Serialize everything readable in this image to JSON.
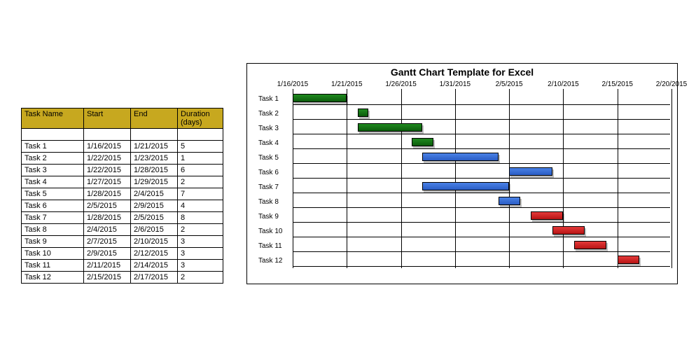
{
  "table": {
    "headers": {
      "name": "Task Name",
      "start": "Start",
      "end": "End",
      "duration": "Duration (days)"
    },
    "rows": [
      {
        "name": "Task 1",
        "start": "1/16/2015",
        "end": "1/21/2015",
        "duration": "5"
      },
      {
        "name": "Task 2",
        "start": "1/22/2015",
        "end": "1/23/2015",
        "duration": "1"
      },
      {
        "name": "Task 3",
        "start": "1/22/2015",
        "end": "1/28/2015",
        "duration": "6"
      },
      {
        "name": "Task 4",
        "start": "1/27/2015",
        "end": "1/29/2015",
        "duration": "2"
      },
      {
        "name": "Task 5",
        "start": "1/28/2015",
        "end": "2/4/2015",
        "duration": "7"
      },
      {
        "name": "Task 6",
        "start": "2/5/2015",
        "end": "2/9/2015",
        "duration": "4"
      },
      {
        "name": "Task 7",
        "start": "1/28/2015",
        "end": "2/5/2015",
        "duration": "8"
      },
      {
        "name": "Task 8",
        "start": "2/4/2015",
        "end": "2/6/2015",
        "duration": "2"
      },
      {
        "name": "Task 9",
        "start": "2/7/2015",
        "end": "2/10/2015",
        "duration": "3"
      },
      {
        "name": "Task 10",
        "start": "2/9/2015",
        "end": "2/12/2015",
        "duration": "3"
      },
      {
        "name": "Task 11",
        "start": "2/11/2015",
        "end": "2/14/2015",
        "duration": "3"
      },
      {
        "name": "Task 12",
        "start": "2/15/2015",
        "end": "2/17/2015",
        "duration": "2"
      }
    ]
  },
  "chart_data": {
    "type": "bar",
    "title": "Gantt Chart Template for Excel",
    "xlabel": "",
    "ylabel": "",
    "x_axis_ticks": [
      "1/16/2015",
      "1/21/2015",
      "1/26/2015",
      "1/31/2015",
      "2/5/2015",
      "2/10/2015",
      "2/15/2015",
      "2/20/2015"
    ],
    "x_range_days": {
      "min": "1/16/2015",
      "max": "2/20/2015",
      "span_days": 35
    },
    "categories": [
      "Task 1",
      "Task 2",
      "Task 3",
      "Task 4",
      "Task 5",
      "Task 6",
      "Task 7",
      "Task 8",
      "Task 9",
      "Task 10",
      "Task 11",
      "Task 12"
    ],
    "series": [
      {
        "name": "Task 1",
        "start_day": 0,
        "duration": 5,
        "color": "green"
      },
      {
        "name": "Task 2",
        "start_day": 6,
        "duration": 1,
        "color": "green"
      },
      {
        "name": "Task 3",
        "start_day": 6,
        "duration": 6,
        "color": "green"
      },
      {
        "name": "Task 4",
        "start_day": 11,
        "duration": 2,
        "color": "green"
      },
      {
        "name": "Task 5",
        "start_day": 12,
        "duration": 7,
        "color": "blue"
      },
      {
        "name": "Task 6",
        "start_day": 20,
        "duration": 4,
        "color": "blue"
      },
      {
        "name": "Task 7",
        "start_day": 12,
        "duration": 8,
        "color": "blue"
      },
      {
        "name": "Task 8",
        "start_day": 19,
        "duration": 2,
        "color": "blue"
      },
      {
        "name": "Task 9",
        "start_day": 22,
        "duration": 3,
        "color": "red"
      },
      {
        "name": "Task 10",
        "start_day": 24,
        "duration": 3,
        "color": "red"
      },
      {
        "name": "Task 11",
        "start_day": 26,
        "duration": 3,
        "color": "red"
      },
      {
        "name": "Task 12",
        "start_day": 30,
        "duration": 2,
        "color": "red"
      }
    ]
  }
}
